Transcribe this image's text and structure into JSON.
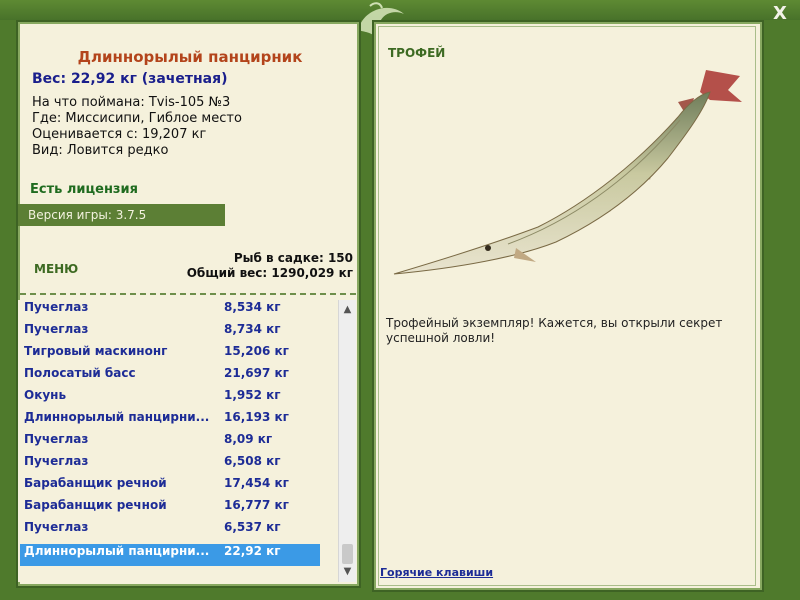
{
  "window": {
    "close_label": "X"
  },
  "fish": {
    "name": "Длиннорылый панцирник",
    "weight": "Вес: 22,92 кг (зачетная)",
    "info": [
      "На что поймана: Tvis-105 №3",
      "Где: Миссисипи, Гиблое место",
      "Оценивается с: 19,207 кг",
      "Вид: Ловится редко"
    ]
  },
  "license": "Есть лицензия",
  "version": "Версия игры: 3.7.5",
  "menu_label": "МЕНЮ",
  "cage": {
    "count": "Рыб в садке: 150",
    "total": "Общий вес: 1290,029 кг"
  },
  "catches": [
    {
      "name": "Пучеглаз",
      "weight": "8,534 кг"
    },
    {
      "name": "Пучеглаз",
      "weight": "8,734 кг"
    },
    {
      "name": "Тигровый маскинонг",
      "weight": "15,206 кг"
    },
    {
      "name": "Полосатый басс",
      "weight": "21,697 кг"
    },
    {
      "name": "Окунь",
      "weight": "1,952 кг"
    },
    {
      "name": "Длиннорылый панцирни...",
      "weight": "16,193 кг"
    },
    {
      "name": "Пучеглаз",
      "weight": "8,09 кг"
    },
    {
      "name": "Пучеглаз",
      "weight": "6,508 кг"
    },
    {
      "name": "Барабанщик речной",
      "weight": "17,454 кг"
    },
    {
      "name": "Барабанщик речной",
      "weight": "16,777 кг"
    },
    {
      "name": "Пучеглаз",
      "weight": "6,537 кг"
    },
    {
      "name": "Длиннорылый панцирни...",
      "weight": "22,92 кг",
      "selected": true
    }
  ],
  "trophy": {
    "label": "ТРОФЕЙ",
    "text": "Трофейный экземпляр! Кажется, вы открыли секрет успешной ловли!"
  },
  "hotkeys_label": "Горячие клавиши",
  "colors": {
    "frame": "#4f7a2c",
    "panel": "#f5f1dc",
    "title": "#b3441b",
    "list_text": "#1d2c96",
    "selection": "#3b9ae6"
  }
}
